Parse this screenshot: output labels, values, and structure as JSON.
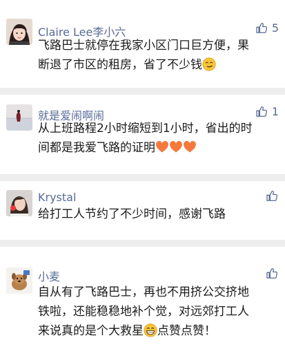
{
  "comments": [
    {
      "author": "Claire Lee李小六",
      "likes": "5",
      "lines": [
        "飞路巴士就停在我家小区门口巨方便，果",
        "断退了市区的租房，省了不少钱"
      ],
      "avatar_icon": "girl-avatar-icon",
      "emoji_icon": "smirk-emoji-icon"
    },
    {
      "author": "就是爱闹啊闹",
      "likes": "1",
      "lines": [
        "从上班路程2小时缩短到1小时，省出的时",
        "间都是我爱飞路的证明"
      ],
      "avatar_icon": "beach-avatar-icon",
      "emoji_icon": "orange-heart-emoji-icon"
    },
    {
      "author": "Krystal",
      "likes": "",
      "lines": [
        "给打工人节约了不少时间，感谢飞路"
      ],
      "avatar_icon": "portrait-avatar-icon"
    },
    {
      "author": "小麦",
      "likes": "",
      "lines": [
        "自从有了飞路巴士，再也不用挤公交挤地",
        "铁啦，还能稳稳地补个觉，对远郊打工人",
        "来说真的是个大救星",
        "点赞点赞！"
      ],
      "avatar_icon": "dog-avatar-icon",
      "emoji_icon": "grin-emoji-icon"
    }
  ],
  "colors": {
    "link_blue": "#576b95",
    "text": "#1a1a1a",
    "divider": "#ededed",
    "heart": "#f47a3c"
  }
}
